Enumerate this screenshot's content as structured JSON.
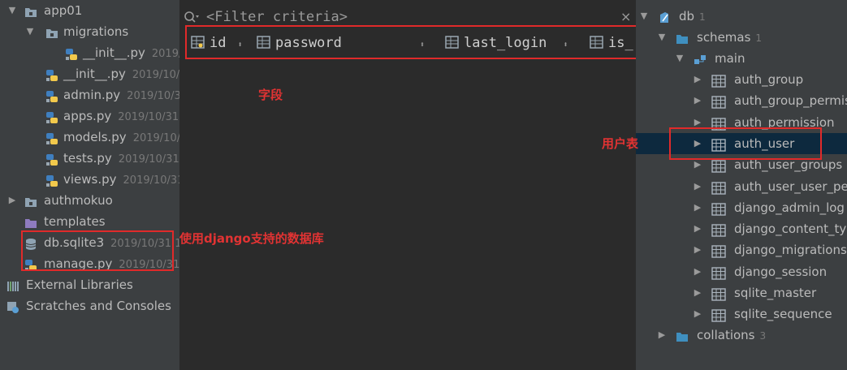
{
  "project_tree": {
    "items": [
      {
        "label": "app01",
        "meta": "",
        "level": 0,
        "expanded": true,
        "icon": "folder-icon"
      },
      {
        "label": "migrations",
        "meta": "",
        "level": 1,
        "expanded": true,
        "icon": "folder-icon"
      },
      {
        "label": "__init__.py",
        "meta": "2019/",
        "level": 2,
        "expanded": null,
        "icon": "python-file-icon"
      },
      {
        "label": "__init__.py",
        "meta": "2019/10/3",
        "level": 1,
        "expanded": null,
        "icon": "python-file-icon"
      },
      {
        "label": "admin.py",
        "meta": "2019/10/3",
        "level": 1,
        "expanded": null,
        "icon": "python-file-icon"
      },
      {
        "label": "apps.py",
        "meta": "2019/10/31",
        "level": 1,
        "expanded": null,
        "icon": "python-file-icon"
      },
      {
        "label": "models.py",
        "meta": "2019/10/",
        "level": 1,
        "expanded": null,
        "icon": "python-file-icon"
      },
      {
        "label": "tests.py",
        "meta": "2019/10/31",
        "level": 1,
        "expanded": null,
        "icon": "python-file-icon"
      },
      {
        "label": "views.py",
        "meta": "2019/10/31",
        "level": 1,
        "expanded": null,
        "icon": "python-file-icon"
      },
      {
        "label": "authmokuo",
        "meta": "",
        "level": 0,
        "expanded": false,
        "icon": "folder-icon"
      },
      {
        "label": "templates",
        "meta": "",
        "level": 0,
        "expanded": null,
        "icon": "purple-folder-icon"
      },
      {
        "label": "db.sqlite3",
        "meta": "2019/10/31 1",
        "level": 0,
        "expanded": null,
        "icon": "database-file-icon"
      },
      {
        "label": "manage.py",
        "meta": "2019/10/31",
        "level": 0,
        "expanded": null,
        "icon": "python-file-icon"
      },
      {
        "label": "External Libraries",
        "meta": "",
        "level": -1,
        "expanded": false,
        "icon": "library-icon"
      },
      {
        "label": "Scratches and Consoles",
        "meta": "",
        "level": -1,
        "expanded": false,
        "icon": "scratches-icon"
      }
    ]
  },
  "filter": {
    "placeholder": "<Filter criteria>",
    "clear_symbol": "×"
  },
  "columns": [
    {
      "name": "id",
      "icon": "primary-key-column-icon"
    },
    {
      "name": "password",
      "icon": "column-icon"
    },
    {
      "name": "last_login",
      "icon": "column-icon"
    },
    {
      "name": "is_",
      "icon": "column-icon"
    }
  ],
  "sort_symbol": "⬍",
  "annotations": {
    "fields": "字段",
    "user_table": "用户表",
    "db_note": "使用django支持的数据库"
  },
  "db_tree": {
    "root": {
      "label": "db",
      "count": "1"
    },
    "schemas": {
      "label": "schemas",
      "count": "1"
    },
    "main": {
      "label": "main"
    },
    "tables": [
      "auth_group",
      "auth_group_permis",
      "auth_permission",
      "auth_user",
      "auth_user_groups",
      "auth_user_user_per",
      "django_admin_log",
      "django_content_ty",
      "django_migrations",
      "django_session",
      "sqlite_master",
      "sqlite_sequence"
    ],
    "selected_table": "auth_user",
    "collations": {
      "label": "collations",
      "count": "3"
    }
  },
  "colors": {
    "accent_red": "#e02a2a",
    "folder": "#8fa3b3",
    "python_blue": "#3f7fbf",
    "python_yellow": "#f2c94c",
    "selection": "#0d293e",
    "db_icon": "#5a9fd4"
  }
}
